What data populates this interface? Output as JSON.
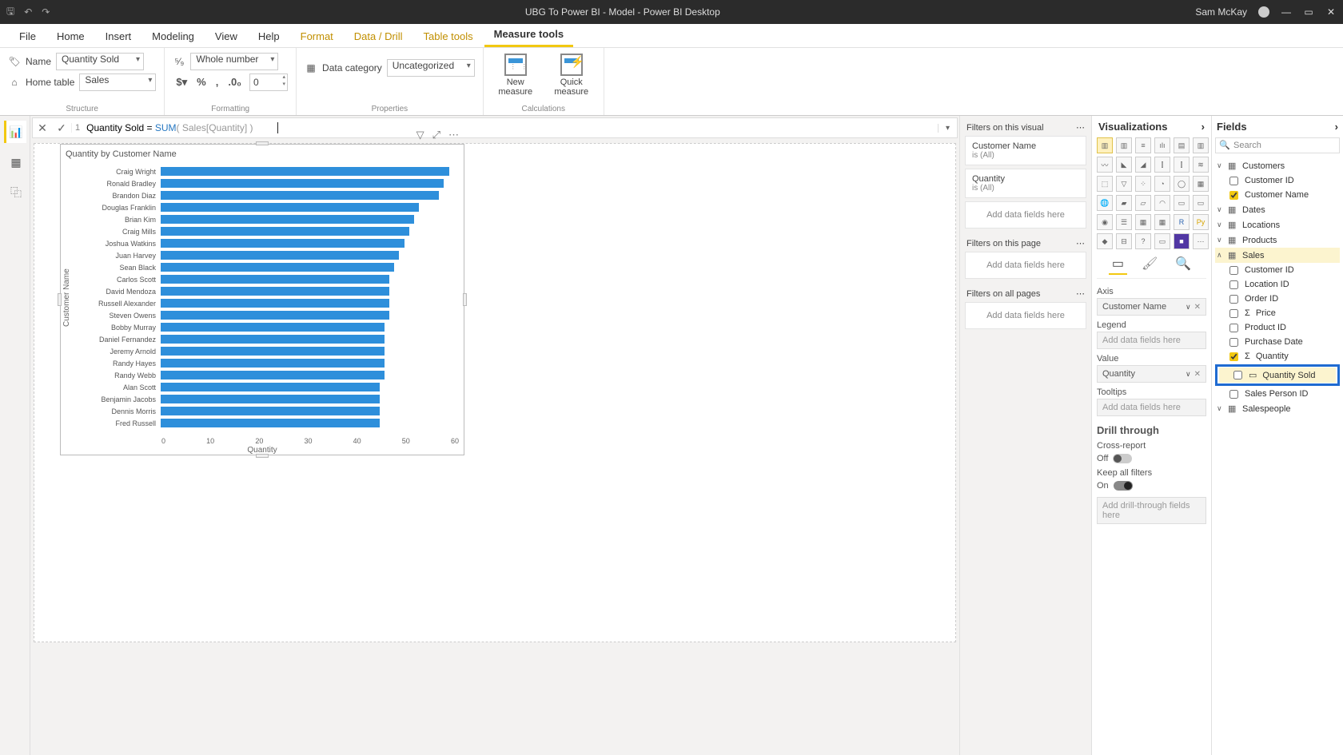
{
  "titlebar": {
    "title": "UBG To Power BI - Model - Power BI Desktop",
    "user": "Sam McKay"
  },
  "tabs": {
    "file": "File",
    "home": "Home",
    "insert": "Insert",
    "modeling": "Modeling",
    "view": "View",
    "help": "Help",
    "format": "Format",
    "data_drill": "Data / Drill",
    "table_tools": "Table tools",
    "measure_tools": "Measure tools"
  },
  "ribbon": {
    "structure": {
      "name_label": "Name",
      "name_value": "Quantity Sold",
      "home_table_label": "Home table",
      "home_table_value": "Sales",
      "group_label": "Structure"
    },
    "formatting": {
      "format_value": "Whole number",
      "decimals": "0",
      "group_label": "Formatting"
    },
    "properties": {
      "data_category_label": "Data category",
      "data_category_value": "Uncategorized",
      "group_label": "Properties"
    },
    "calculations": {
      "new_measure": "New measure",
      "quick_measure": "Quick measure",
      "group_label": "Calculations"
    }
  },
  "formula": {
    "lineno": "1",
    "plain": "Quantity Sold = ",
    "fn": "SUM",
    "args": "( Sales[Quantity] )"
  },
  "chart_data": {
    "type": "bar",
    "title": "Quantity by Customer Name",
    "ylabel": "Customer Name",
    "xlabel": "Quantity",
    "xlim": [
      0,
      60
    ],
    "ticks": [
      "0",
      "10",
      "20",
      "30",
      "40",
      "50",
      "60"
    ],
    "categories": [
      "Craig Wright",
      "Ronald Bradley",
      "Brandon Diaz",
      "Douglas Franklin",
      "Brian Kim",
      "Craig Mills",
      "Joshua Watkins",
      "Juan Harvey",
      "Sean Black",
      "Carlos Scott",
      "David Mendoza",
      "Russell Alexander",
      "Steven Owens",
      "Bobby Murray",
      "Daniel Fernandez",
      "Jeremy Arnold",
      "Randy Hayes",
      "Randy Webb",
      "Alan Scott",
      "Benjamin Jacobs",
      "Dennis Morris",
      "Fred Russell"
    ],
    "values": [
      58,
      57,
      56,
      52,
      51,
      50,
      49,
      48,
      47,
      46,
      46,
      46,
      46,
      45,
      45,
      45,
      45,
      45,
      44,
      44,
      44,
      44
    ]
  },
  "filters": {
    "on_visual_label": "Filters on this visual",
    "on_visual": [
      {
        "name": "Customer Name",
        "state": "is (All)"
      },
      {
        "name": "Quantity",
        "state": "is (All)"
      }
    ],
    "on_page_label": "Filters on this page",
    "on_all_label": "Filters on all pages",
    "drop_text": "Add data fields here"
  },
  "viz": {
    "header": "Visualizations",
    "axis_label": "Axis",
    "axis_value": "Customer Name",
    "legend_label": "Legend",
    "legend_drop": "Add data fields here",
    "value_label": "Value",
    "value_value": "Quantity",
    "tooltips_label": "Tooltips",
    "tooltips_drop": "Add data fields here",
    "drill_header": "Drill through",
    "cross_label": "Cross-report",
    "cross_state": "Off",
    "keep_label": "Keep all filters",
    "keep_state": "On",
    "drill_drop": "Add drill-through fields here"
  },
  "fields": {
    "header": "Fields",
    "search_placeholder": "Search",
    "tables": {
      "customers": {
        "name": "Customers",
        "fields": [
          "Customer ID",
          "Customer Name"
        ]
      },
      "dates": {
        "name": "Dates"
      },
      "locations": {
        "name": "Locations"
      },
      "products": {
        "name": "Products"
      },
      "sales": {
        "name": "Sales",
        "fields": [
          "Customer ID",
          "Location ID",
          "Order ID",
          "Price",
          "Product ID",
          "Purchase Date",
          "Quantity",
          "Quantity Sold",
          "Sales Person ID"
        ]
      },
      "salespeople": {
        "name": "Salespeople"
      }
    }
  }
}
